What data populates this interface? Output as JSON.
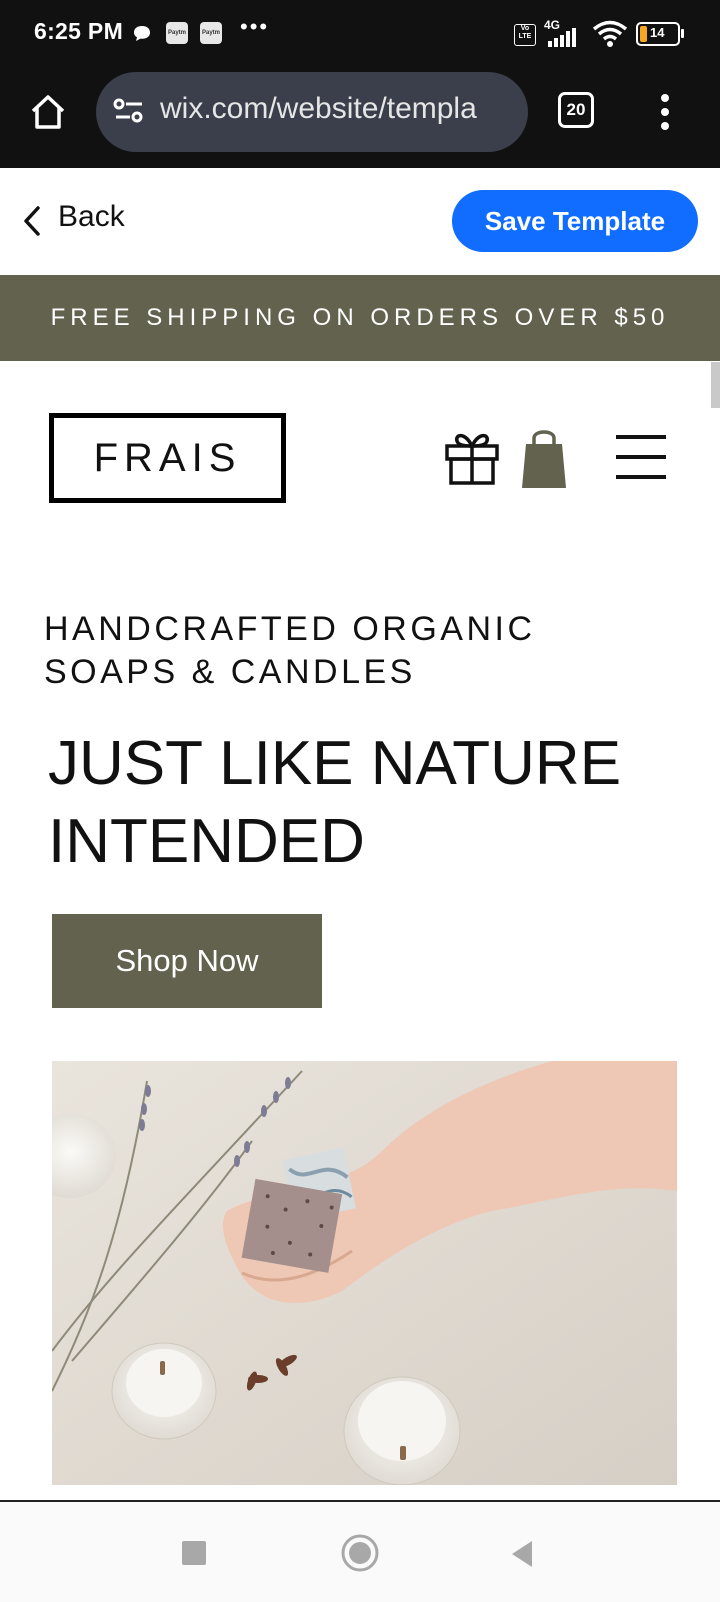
{
  "status_bar": {
    "time": "6:25 PM",
    "paytm_label": "Paytm",
    "overflow": "•••",
    "volte": "Vo LTE",
    "network": "4G",
    "battery": "14"
  },
  "browser": {
    "url": "wix.com/website/templa",
    "tab_count": "20"
  },
  "wix_header": {
    "back_label": "Back",
    "save_label": "Save Template",
    "accent_color": "#116dff"
  },
  "site": {
    "banner_text": "FREE SHIPPING ON ORDERS OVER $50",
    "brand_color": "#62624e",
    "logo_text": "FRAIS",
    "subheading_line1": "HANDCRAFTED ORGANIC",
    "subheading_line2": "SOAPS & CANDLES",
    "headline_line1": "JUST LIKE NATURE",
    "headline_line2": "INTENDED",
    "shop_button": "Shop Now"
  },
  "icons": {
    "home": "home-icon",
    "site_info": "site-settings-icon",
    "menu": "more-vert-icon",
    "back": "chevron-left-icon",
    "gift": "gift-icon",
    "cart": "shopping-bag-icon",
    "hamburger": "hamburger-menu-icon"
  }
}
